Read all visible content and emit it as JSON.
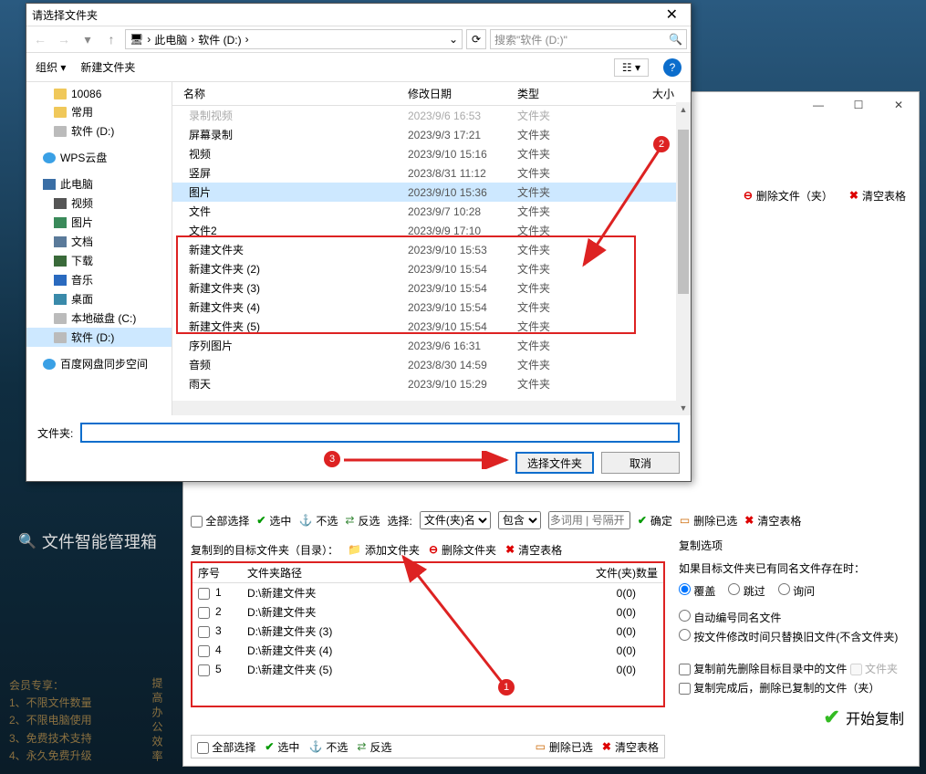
{
  "dialog": {
    "title": "请选择文件夹",
    "breadcrumb": {
      "pc": "此电脑",
      "drive": "软件 (D:)"
    },
    "search_placeholder": "搜索\"软件 (D:)\"",
    "organize": "组织 ▾",
    "new_folder": "新建文件夹",
    "view_toggle": "☷ ▾",
    "columns": {
      "name": "名称",
      "date": "修改日期",
      "type": "类型",
      "size": "大小"
    },
    "tree": [
      {
        "icon": "folder",
        "label": "10086",
        "lvl": 1
      },
      {
        "icon": "folder",
        "label": "常用",
        "lvl": 1
      },
      {
        "icon": "disk",
        "label": "软件 (D:)",
        "lvl": 1
      },
      {
        "icon": "cloud",
        "label": "WPS云盘",
        "lvl": 0,
        "spacer": true
      },
      {
        "icon": "pc",
        "label": "此电脑",
        "lvl": 0,
        "spacer": true
      },
      {
        "icon": "video",
        "label": "视频",
        "lvl": 1
      },
      {
        "icon": "pic",
        "label": "图片",
        "lvl": 1
      },
      {
        "icon": "doc",
        "label": "文档",
        "lvl": 1
      },
      {
        "icon": "dl",
        "label": "下载",
        "lvl": 1
      },
      {
        "icon": "music",
        "label": "音乐",
        "lvl": 1
      },
      {
        "icon": "desktop2",
        "label": "桌面",
        "lvl": 1
      },
      {
        "icon": "disk",
        "label": "本地磁盘 (C:)",
        "lvl": 1
      },
      {
        "icon": "disk",
        "label": "软件 (D:)",
        "lvl": 1,
        "sel": true
      },
      {
        "icon": "cloud",
        "label": "百度网盘同步空间",
        "lvl": 0,
        "spacer": true
      }
    ],
    "rows": [
      {
        "name": "录制视频",
        "date": "2023/9/6 16:53",
        "type": "文件夹",
        "cut": true
      },
      {
        "name": "屏幕录制",
        "date": "2023/9/3 17:21",
        "type": "文件夹"
      },
      {
        "name": "视频",
        "date": "2023/9/10 15:16",
        "type": "文件夹"
      },
      {
        "name": "竖屏",
        "date": "2023/8/31 11:12",
        "type": "文件夹"
      },
      {
        "name": "图片",
        "date": "2023/9/10 15:36",
        "type": "文件夹",
        "sel": true
      },
      {
        "name": "文件",
        "date": "2023/9/7 10:28",
        "type": "文件夹"
      },
      {
        "name": "文件2",
        "date": "2023/9/9 17:10",
        "type": "文件夹"
      },
      {
        "name": "新建文件夹",
        "date": "2023/9/10 15:53",
        "type": "文件夹"
      },
      {
        "name": "新建文件夹 (2)",
        "date": "2023/9/10 15:54",
        "type": "文件夹"
      },
      {
        "name": "新建文件夹 (3)",
        "date": "2023/9/10 15:54",
        "type": "文件夹"
      },
      {
        "name": "新建文件夹 (4)",
        "date": "2023/9/10 15:54",
        "type": "文件夹"
      },
      {
        "name": "新建文件夹 (5)",
        "date": "2023/9/10 15:54",
        "type": "文件夹"
      },
      {
        "name": "序列图片",
        "date": "2023/9/6 16:31",
        "type": "文件夹"
      },
      {
        "name": "音频",
        "date": "2023/8/30 14:59",
        "type": "文件夹"
      },
      {
        "name": "雨天",
        "date": "2023/9/10 15:29",
        "type": "文件夹"
      }
    ],
    "folder_label": "文件夹:",
    "select_btn": "选择文件夹",
    "cancel_btn": "取消"
  },
  "app": {
    "title": "文件智能管理箱",
    "row1": {
      "delete_file": "删除文件（夹）",
      "clear_table": "清空表格"
    },
    "filter": {
      "select_all": "全部选择",
      "sel": "选中",
      "unsel": "不选",
      "invert": "反选",
      "choose_label": "选择:",
      "mode_name": "文件(夹)名",
      "mode_contains": "包含",
      "keywords_ph": "多词用 | 号隔开",
      "confirm": "确定",
      "delete_selected": "删除已选",
      "clear_table": "清空表格"
    },
    "target": {
      "label": "复制到的目标文件夹（目录）：",
      "add_folder": "添加文件夹",
      "delete_folder": "删除文件夹",
      "clear_table": "清空表格",
      "col_idx": "序号",
      "col_path": "文件夹路径",
      "col_count": "文件(夹)数量",
      "rows": [
        {
          "i": "1",
          "path": "D:\\新建文件夹",
          "count": "0(0)"
        },
        {
          "i": "2",
          "path": "D:\\新建文件夹",
          "count": "0(0)"
        },
        {
          "i": "3",
          "path": "D:\\新建文件夹 (3)",
          "count": "0(0)"
        },
        {
          "i": "4",
          "path": "D:\\新建文件夹 (4)",
          "count": "0(0)"
        },
        {
          "i": "5",
          "path": "D:\\新建文件夹 (5)",
          "count": "0(0)"
        }
      ]
    },
    "options": {
      "title": "复制选项",
      "line1": "如果目标文件夹已有同名文件存在时：",
      "r_over": "覆盖",
      "r_skip": "跳过",
      "r_ask": "询问",
      "auto_rename": "自动编号同名文件",
      "by_mtime": "按文件修改时间只替换旧文件(不含文件夹)",
      "pre_delete": "复制前先删除目标目录中的文件",
      "folder_suffix": "文件夹",
      "post_delete": "复制完成后，删除已复制的文件（夹）"
    },
    "start": "开始复制",
    "bottom": {
      "select_all": "全部选择",
      "sel": "选中",
      "unsel": "不选",
      "invert": "反选",
      "delete_selected": "删除已选",
      "clear_table": "清空表格"
    }
  },
  "member": {
    "header": "会员专享：",
    "l1": "1、不限文件数量",
    "l2": "2、不限电脑使用",
    "l3": "3、免费技术支持",
    "l4": "4、永久免费升级",
    "side": "提高办公效率"
  }
}
